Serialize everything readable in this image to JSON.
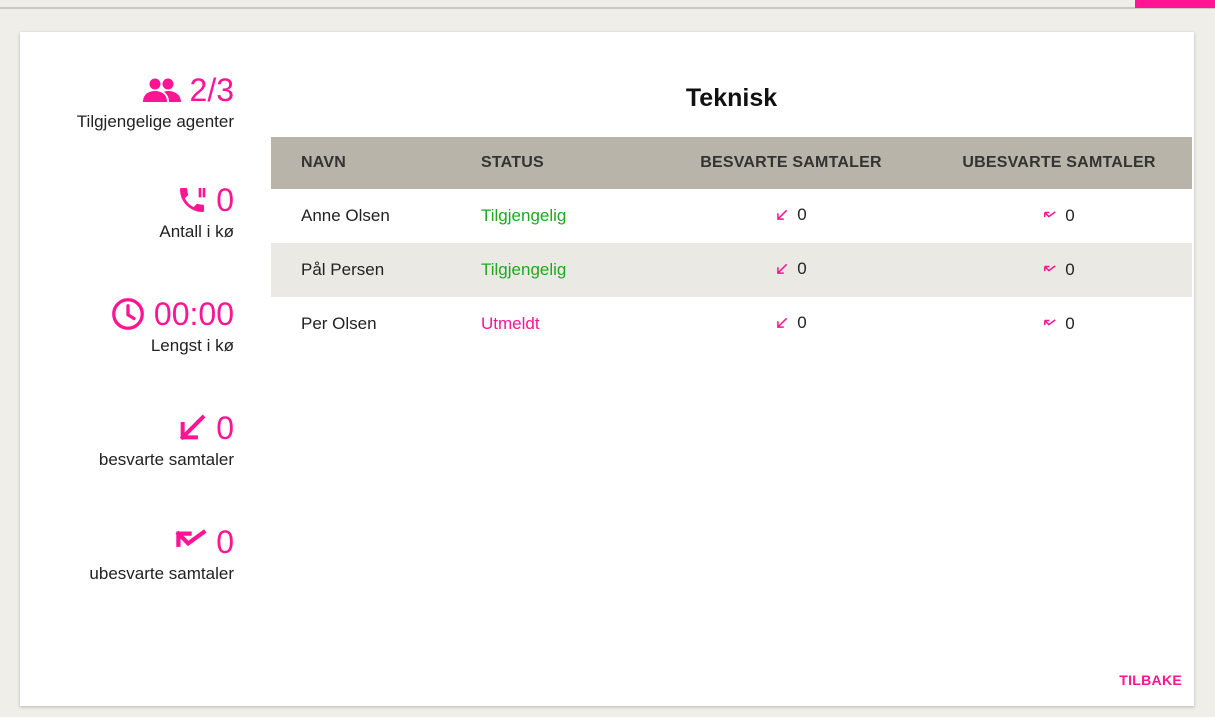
{
  "colors": {
    "accent": "#ff1493",
    "available": "#1fa81f",
    "header_bg": "#b9b4a9",
    "row_alt_bg": "#ebe9e3",
    "page_bg": "#efeee9"
  },
  "stats": {
    "agents": {
      "value": "2/3",
      "label": "Tilgjengelige agenter",
      "icon": "people-icon"
    },
    "queue": {
      "value": "0",
      "label": "Antall i kø",
      "icon": "phone-paused-icon"
    },
    "longest": {
      "value": "00:00",
      "label": "Lengst i kø",
      "icon": "clock-icon"
    },
    "answered": {
      "value": "0",
      "label": "besvarte samtaler",
      "icon": "call-received-icon"
    },
    "missed": {
      "value": "0",
      "label": "ubesvarte samtaler",
      "icon": "call-missed-icon"
    }
  },
  "queue_title": "Teknisk",
  "table": {
    "headers": [
      "NAVN",
      "STATUS",
      "BESVARTE SAMTALER",
      "UBESVARTE SAMTALER"
    ],
    "rows": [
      {
        "name": "Anne Olsen",
        "status": "Tilgjengelig",
        "status_type": "available",
        "answered": "0",
        "missed": "0"
      },
      {
        "name": "Pål Persen",
        "status": "Tilgjengelig",
        "status_type": "available",
        "answered": "0",
        "missed": "0"
      },
      {
        "name": "Per Olsen",
        "status": "Utmeldt",
        "status_type": "offline",
        "answered": "0",
        "missed": "0"
      }
    ]
  },
  "back_label": "TILBAKE"
}
